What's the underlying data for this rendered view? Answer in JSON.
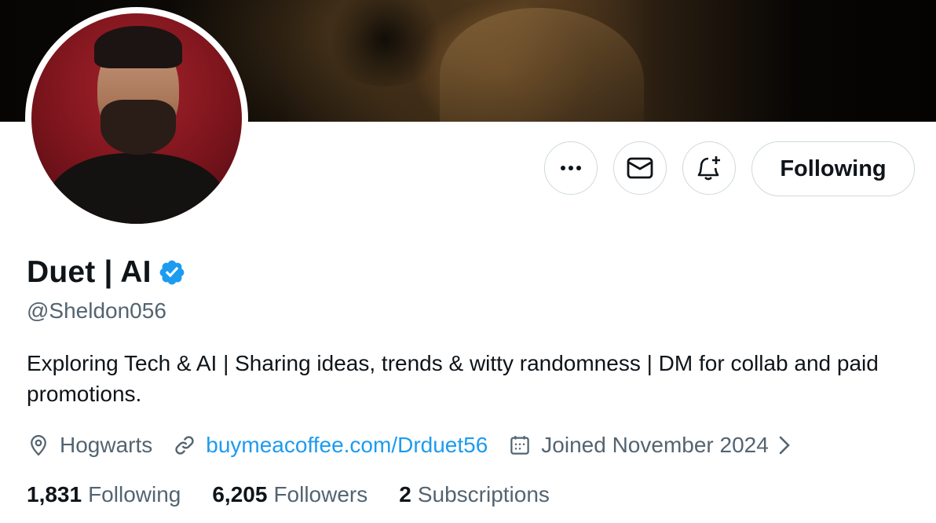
{
  "profile": {
    "display_name": "Duet | AI",
    "handle": "@Sheldon056",
    "bio": "Exploring Tech & AI | Sharing ideas, trends & witty randomness | DM for collab and paid promotions.",
    "verified": true
  },
  "actions": {
    "more_icon": "more-icon",
    "message_icon": "envelope-icon",
    "notify_icon": "bell-plus-icon",
    "follow_label": "Following"
  },
  "meta": {
    "location": "Hogwarts",
    "website": "buymeacoffee.com/Drduet56",
    "joined": "Joined November 2024"
  },
  "stats": {
    "following_count": "1,831",
    "following_label": "Following",
    "followers_count": "6,205",
    "followers_label": "Followers",
    "subscriptions_count": "2",
    "subscriptions_label": "Subscriptions"
  },
  "colors": {
    "accent": "#1d9bf0",
    "secondary_text": "#536471",
    "border": "#cfd9de"
  }
}
